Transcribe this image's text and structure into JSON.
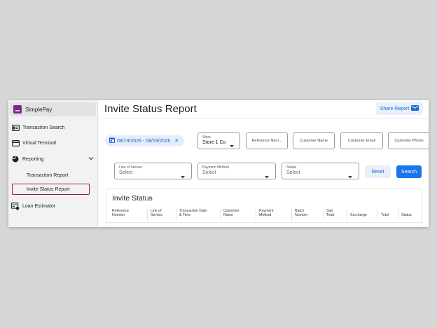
{
  "app": {
    "name": "SimplePay"
  },
  "sidebar": {
    "items": [
      {
        "label": "Transaction Search",
        "icon": "id-card-icon"
      },
      {
        "label": "Virtual Terminal",
        "icon": "credit-card-icon"
      },
      {
        "label": "Reporting",
        "icon": "pie-chart-icon",
        "expanded": true
      },
      {
        "label": "Loan Estimator",
        "icon": "calculator-icon"
      }
    ],
    "reporting_sub": [
      {
        "label": "Transaction Report",
        "active": false
      },
      {
        "label": "Invite Status Report",
        "active": true
      }
    ]
  },
  "page": {
    "title": "Invite Status Report",
    "share_label": "Share Report"
  },
  "filters": {
    "date_range": "08/19/2026 - 08/19/2026",
    "store": {
      "label": "Store",
      "value": "Store 1 Co"
    },
    "reference_number": {
      "placeholder": "Reference Num..."
    },
    "customer_name": {
      "placeholder": "Customer Name"
    },
    "customer_email": {
      "placeholder": "Customer Email"
    },
    "customer_phone": {
      "placeholder": "Customer Phone"
    },
    "line_of_service": {
      "label": "Line of Service",
      "value": "Select"
    },
    "payment_method": {
      "label": "Payment Method",
      "value": "Select"
    },
    "status": {
      "label": "Status",
      "value": "Select"
    },
    "reset_label": "Reset",
    "search_label": "Search"
  },
  "table": {
    "title": "Invite Status",
    "columns": [
      [
        "Reference",
        "Number"
      ],
      [
        "Line of",
        "Service"
      ],
      [
        "Transaction Date",
        "& Time"
      ],
      [
        "Customer",
        "Name"
      ],
      [
        "Payment",
        "Method"
      ],
      [
        "Batch",
        "Number"
      ],
      [
        "Sub",
        "Total"
      ],
      [
        "",
        "Surcharge"
      ],
      [
        "",
        "Total"
      ],
      [
        "",
        "Status"
      ]
    ]
  },
  "colors": {
    "accent": "#1a73e8",
    "brand": "#7a2a8a",
    "active_outline": "#9b1c2e"
  }
}
